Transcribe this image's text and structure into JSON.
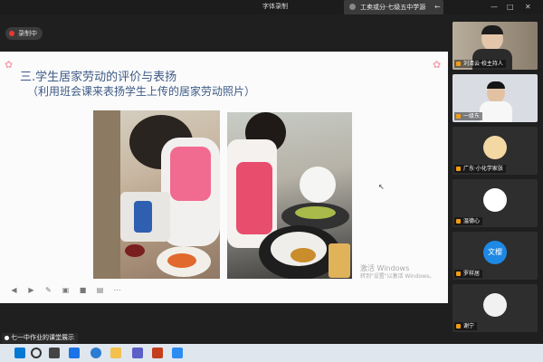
{
  "window": {
    "title": "字体录制",
    "meeting_title": "工卖或分·七级五中学源"
  },
  "recording": {
    "label": "录制中"
  },
  "slide": {
    "title": "三.学生居家劳动的评价与表扬",
    "subtitle": "（利用班会课来表扬学生上传的居家劳动照片）",
    "watermark_line1": "激活 Windows",
    "watermark_line2": "转到\"设置\"以激活 Windows。",
    "toolbar": [
      "prev-icon",
      "play-icon",
      "pen-icon",
      "fullscreen-icon",
      "video-icon",
      "subtitle-icon",
      "more-icon"
    ]
  },
  "participants": [
    {
      "name": "刘清云·校主持人",
      "kind": "video",
      "bg": "#9b8f80"
    },
    {
      "name": "一级东",
      "kind": "video",
      "bg": "#d9dde3"
    },
    {
      "name": "广东·小化学家张",
      "kind": "avatar",
      "bg": "#f4d8a4"
    },
    {
      "name": "温德心",
      "kind": "avatar",
      "bg": "#ffffff"
    },
    {
      "name": "罗样居",
      "kind": "initials",
      "initials": "文樱",
      "bg": "#1e88e5"
    },
    {
      "name": "谢宁",
      "kind": "avatar",
      "bg": "#f1f1f1"
    }
  ],
  "caption": {
    "text": "七一中作业的课堂展示"
  },
  "taskbar": {
    "icons": [
      "windows-start-icon",
      "search-icon",
      "task-view-icon",
      "widgets-icon",
      "edge-icon",
      "file-explorer-icon",
      "store-icon",
      "powerpoint-icon",
      "meeting-app-icon"
    ],
    "colors": [
      "#0078d4",
      "#333333",
      "#444444",
      "#1a73e8",
      "#2b7cd3",
      "#f2c14e",
      "#5b5fc7",
      "#c43e1c",
      "#2d8cf0"
    ]
  }
}
